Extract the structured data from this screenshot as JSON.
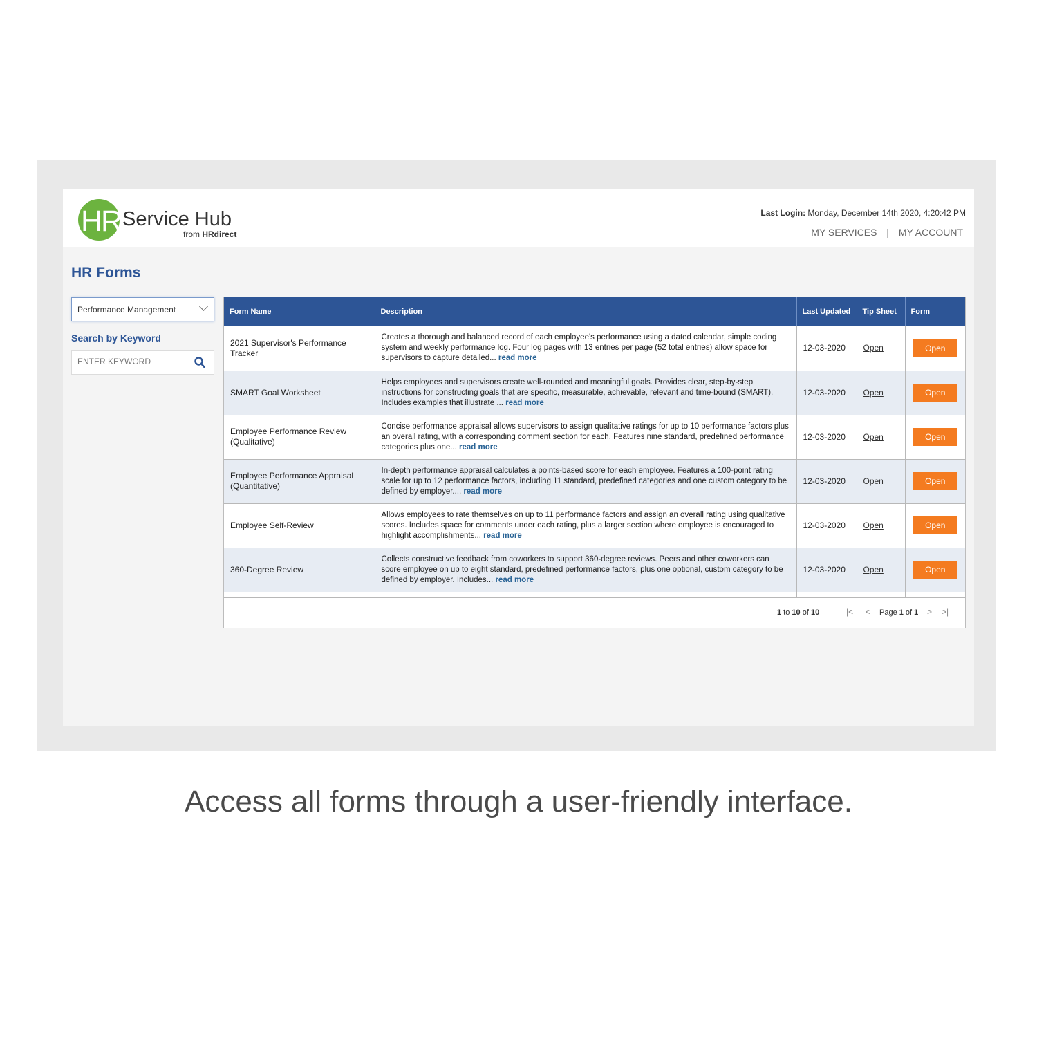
{
  "header": {
    "logo": {
      "mark": "HR",
      "title": "Service Hub",
      "sub_prefix": "from ",
      "sub_brand": "HRdirect"
    },
    "last_login_label": "Last Login:",
    "last_login_value": " Monday, December 14th 2020, 4:20:42 PM",
    "nav": {
      "services": "MY SERVICES",
      "separator": "|",
      "account": "MY ACCOUNT"
    }
  },
  "page_title": "HR Forms",
  "category_select": {
    "value": "Performance Management"
  },
  "search": {
    "label": "Search by Keyword",
    "placeholder": "ENTER KEYWORD",
    "icon": "search-icon"
  },
  "table": {
    "columns": [
      "Form Name",
      "Description",
      "Last Updated",
      "Tip Sheet",
      "Form"
    ],
    "rows": [
      {
        "name": "2021 Supervisor's Performance Tracker",
        "description": "Creates a thorough and balanced record of each employee's performance using a dated calendar, simple coding system and weekly performance log. Four log pages with 13 entries per page (52 total entries) allow space for supervisors to capture detailed...",
        "read_more": "read more",
        "updated": "12-03-2020",
        "tip": "Open",
        "form": "Open"
      },
      {
        "name": "SMART Goal Worksheet",
        "description": "Helps employees and supervisors create well-rounded and meaningful goals. Provides clear, step-by-step instructions for constructing goals that are specific, measurable, achievable, relevant and time-bound (SMART). Includes examples that illustrate ...",
        "read_more": "read more",
        "updated": "12-03-2020",
        "tip": "Open",
        "form": "Open"
      },
      {
        "name": "Employee Performance Review (Qualitative)",
        "description": "Concise performance appraisal allows supervisors to assign qualitative ratings for up to 10 performance factors plus an overall rating, with a corresponding comment section for each. Features nine standard, predefined performance categories plus one...",
        "read_more": "read more",
        "updated": "12-03-2020",
        "tip": "Open",
        "form": "Open"
      },
      {
        "name": "Employee Performance Appraisal (Quantitative)",
        "description": "In-depth performance appraisal calculates a points-based score for each employee. Features a 100-point rating scale for up to 12 performance factors, including 11 standard, predefined categories and one custom category to be defined by employer....",
        "read_more": "read more",
        "updated": "12-03-2020",
        "tip": "Open",
        "form": "Open"
      },
      {
        "name": "Employee Self-Review",
        "description": "Allows employees to rate themselves on up to 11 performance factors and assign an overall rating using qualitative scores. Includes space for comments under each rating, plus a larger section where employee is encouraged to highlight accomplishments...",
        "read_more": "read more",
        "updated": "12-03-2020",
        "tip": "Open",
        "form": "Open"
      },
      {
        "name": "360-Degree Review",
        "description": "Collects constructive feedback from coworkers to support 360-degree reviews. Peers and other coworkers can score employee on up to eight standard, predefined performance factors, plus one optional, custom category to be defined by employer. Includes...",
        "read_more": "read more",
        "updated": "12-03-2020",
        "tip": "Open",
        "form": "Open"
      }
    ]
  },
  "pager": {
    "from": "1",
    "to_word": " to ",
    "to": "10",
    "of_word": " of ",
    "total": "10",
    "page_word": "Page ",
    "page": "1",
    "page_of_word": " of ",
    "pages": "1",
    "first": "|<",
    "prev": "<",
    "next": ">",
    "last": ">|"
  },
  "caption": "Access all forms through a user-friendly interface.",
  "colors": {
    "brand_blue": "#2d5596",
    "accent_orange": "#f47b20",
    "logo_green": "#6cb33f"
  }
}
